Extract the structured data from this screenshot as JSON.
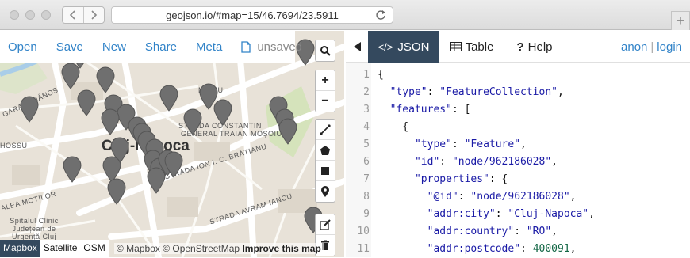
{
  "browser": {
    "url": "geojson.io/#map=15/46.7694/23.5911"
  },
  "map_toolbar": {
    "open": "Open",
    "save": "Save",
    "new": "New",
    "share": "Share",
    "meta": "Meta",
    "file_status": "unsaved"
  },
  "map": {
    "city_label": "Cluj-Napoca",
    "street_labels": [
      "GARANY JÁNOS",
      "STRADA CONSTANTIN",
      "GENERAL TRAIAN MOȘOIU",
      "STRADA ION I. C. BRĂTIANU",
      "STRADA AVRAM IANCU",
      "ALEA MOTILOR",
      "HOSSU",
      "Spitalul Clinic Județean de Urgență Cluj",
      "MANIU"
    ],
    "layers": [
      "Mapbox",
      "Satellite",
      "OSM"
    ],
    "active_layer": "Mapbox",
    "attribution": "© Mapbox © OpenStreetMap",
    "attribution_link": "Improve this map",
    "zoom_in": "+",
    "zoom_out": "−",
    "pin_color": "#6f6f6f"
  },
  "panel": {
    "tabs": [
      {
        "label": "JSON",
        "icon": "code-icon",
        "active": true
      },
      {
        "label": "Table",
        "icon": "table-icon",
        "active": false
      },
      {
        "label": "Help",
        "icon": "question-icon",
        "active": false
      }
    ],
    "user": "anon",
    "login": "login",
    "accent_color": "#34495e",
    "link_color": "#3183c8"
  },
  "editor": {
    "lines": [
      {
        "n": "1",
        "text": "{"
      },
      {
        "n": "2",
        "text": "  \"type\": \"FeatureCollection\","
      },
      {
        "n": "3",
        "text": "  \"features\": ["
      },
      {
        "n": "4",
        "text": "    {"
      },
      {
        "n": "5",
        "text": "      \"type\": \"Feature\","
      },
      {
        "n": "6",
        "text": "      \"id\": \"node/962186028\","
      },
      {
        "n": "7",
        "text": "      \"properties\": {"
      },
      {
        "n": "8",
        "text": "        \"@id\": \"node/962186028\","
      },
      {
        "n": "9",
        "text": "        \"addr:city\": \"Cluj-Napoca\","
      },
      {
        "n": "10",
        "text": "        \"addr:country\": \"RO\","
      },
      {
        "n": "11",
        "text": "        \"addr:postcode\": 400091,"
      }
    ]
  }
}
